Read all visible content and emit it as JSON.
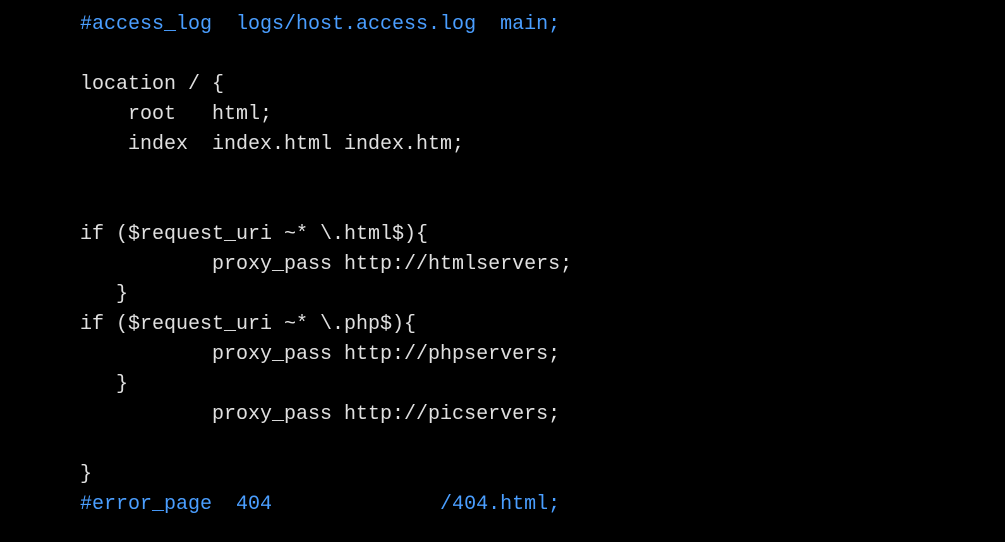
{
  "code": {
    "lines": [
      {
        "text": "#access_log  logs/host.access.log  main;",
        "class": "comment"
      },
      {
        "text": "",
        "class": "normal"
      },
      {
        "text": "location / {",
        "class": "normal"
      },
      {
        "text": "    root   html;",
        "class": "normal"
      },
      {
        "text": "    index  index.html index.htm;",
        "class": "normal"
      },
      {
        "text": "",
        "class": "normal"
      },
      {
        "text": "",
        "class": "normal"
      },
      {
        "text": "if ($request_uri ~* \\.html$){",
        "class": "normal"
      },
      {
        "text": "           proxy_pass http://htmlservers;",
        "class": "normal"
      },
      {
        "text": "   }",
        "class": "normal"
      },
      {
        "text": "if ($request_uri ~* \\.php$){",
        "class": "normal"
      },
      {
        "text": "           proxy_pass http://phpservers;",
        "class": "normal"
      },
      {
        "text": "   }",
        "class": "normal"
      },
      {
        "text": "           proxy_pass http://picservers;",
        "class": "normal"
      },
      {
        "text": "",
        "class": "normal"
      },
      {
        "text": "}",
        "class": "normal"
      },
      {
        "text": "#error_page  404              /404.html;",
        "class": "comment"
      }
    ]
  }
}
